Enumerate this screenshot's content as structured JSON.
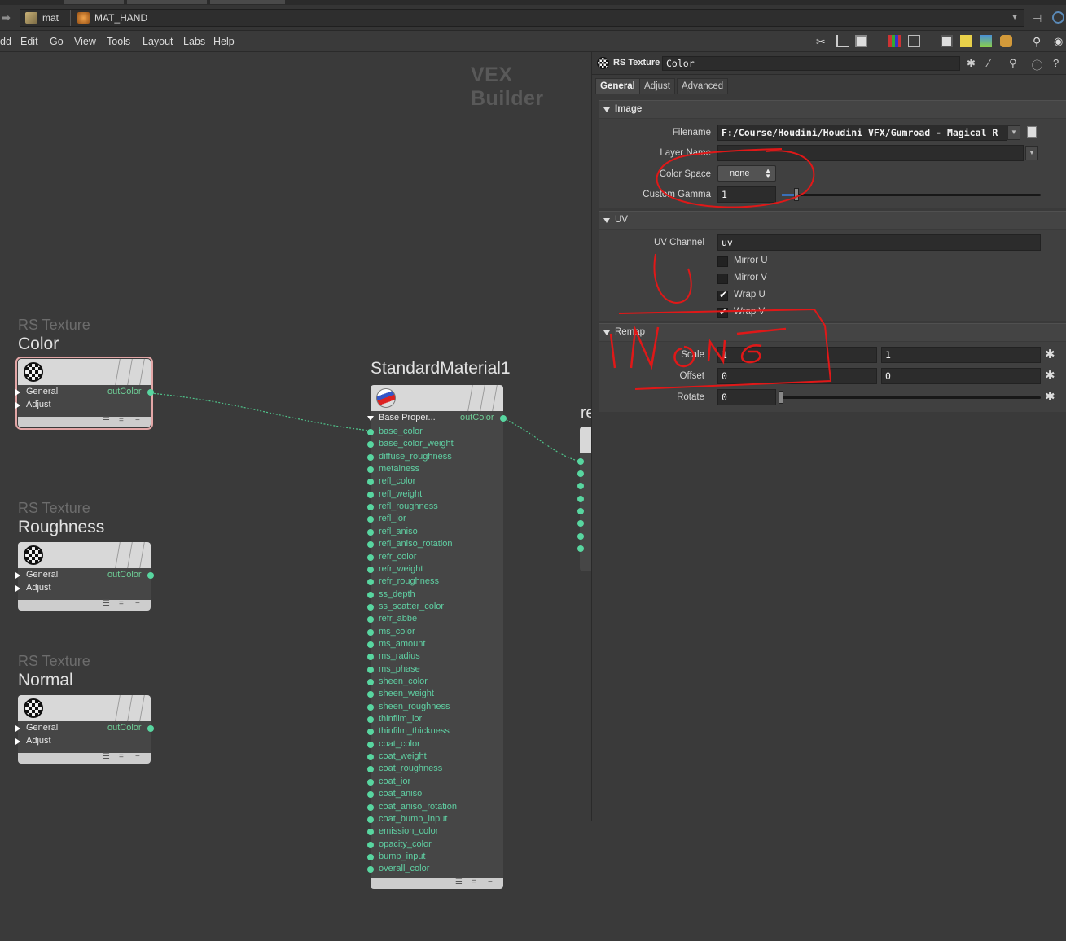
{
  "breadcrumb": {
    "root": "mat",
    "node": "MAT_HAND"
  },
  "menu": [
    "dd",
    "Edit",
    "Go",
    "View",
    "Tools",
    "Layout",
    "Labs",
    "Help"
  ],
  "network": {
    "context_title": "VEX Builder",
    "nodes": {
      "color": {
        "type": "RS Texture",
        "name": "Color",
        "sections": [
          "General",
          "Adjust"
        ],
        "output": "outColor"
      },
      "roughness": {
        "type": "RS Texture",
        "name": "Roughness",
        "sections": [
          "General",
          "Adjust"
        ],
        "output": "outColor"
      },
      "normal": {
        "type": "RS Texture",
        "name": "Normal",
        "sections": [
          "General",
          "Adjust"
        ],
        "output": "outColor"
      },
      "material": {
        "name": "StandardMaterial1",
        "section": "Base Proper...",
        "output": "outColor",
        "inputs": [
          "base_color",
          "base_color_weight",
          "diffuse_roughness",
          "metalness",
          "refl_color",
          "refl_weight",
          "refl_roughness",
          "refl_ior",
          "refl_aniso",
          "refl_aniso_rotation",
          "refr_color",
          "refr_weight",
          "refr_roughness",
          "ss_depth",
          "ss_scatter_color",
          "refr_abbe",
          "ms_color",
          "ms_amount",
          "ms_radius",
          "ms_phase",
          "sheen_color",
          "sheen_weight",
          "sheen_roughness",
          "thinfilm_ior",
          "thinfilm_thickness",
          "coat_color",
          "coat_weight",
          "coat_roughness",
          "coat_ior",
          "coat_aniso",
          "coat_aniso_rotation",
          "coat_bump_input",
          "emission_color",
          "opacity_color",
          "bump_input",
          "overall_color"
        ]
      },
      "partial_label": "re"
    }
  },
  "params": {
    "node_type": "RS Texture",
    "node_name": "Color",
    "tabs": [
      "General",
      "Adjust",
      "Advanced"
    ],
    "active_tab": "General",
    "image": {
      "folder": "Image",
      "filename_label": "Filename",
      "filename_value": "F:/Course/Houdini/Houdini VFX/Gumroad - Magical R",
      "layer_label": "Layer Name",
      "layer_value": "",
      "colorspace_label": "Color Space",
      "colorspace_value": "none",
      "gamma_label": "Custom Gamma",
      "gamma_value": "1"
    },
    "uv": {
      "folder": "UV",
      "channel_label": "UV Channel",
      "channel_value": "uv",
      "mirror_u": {
        "label": "Mirror U",
        "checked": false
      },
      "mirror_v": {
        "label": "Mirror V",
        "checked": false
      },
      "wrap_u": {
        "label": "Wrap U",
        "checked": true
      },
      "wrap_v": {
        "label": "Wrap V",
        "checked": true
      }
    },
    "remap": {
      "folder": "Remap",
      "scale_label": "Scale",
      "scale_x": "1",
      "scale_y": "1",
      "offset_label": "Offset",
      "offset_x": "0",
      "offset_y": "0",
      "rotate_label": "Rotate",
      "rotate_value": "0"
    }
  },
  "colors": {
    "wire": "#4fc38a",
    "port": "#58d6a0",
    "annotation": "#e01818",
    "selected_outline": "#e3a6a6"
  },
  "icons": [
    "back-arrow-icon",
    "mat-context-icon",
    "hand-object-icon",
    "pin-icon",
    "link-icon",
    "texture-checker-icon",
    "material-ball-icon",
    "gear-icon",
    "brush-icon",
    "search-icon",
    "info-icon",
    "help-icon",
    "file-browse-icon"
  ]
}
